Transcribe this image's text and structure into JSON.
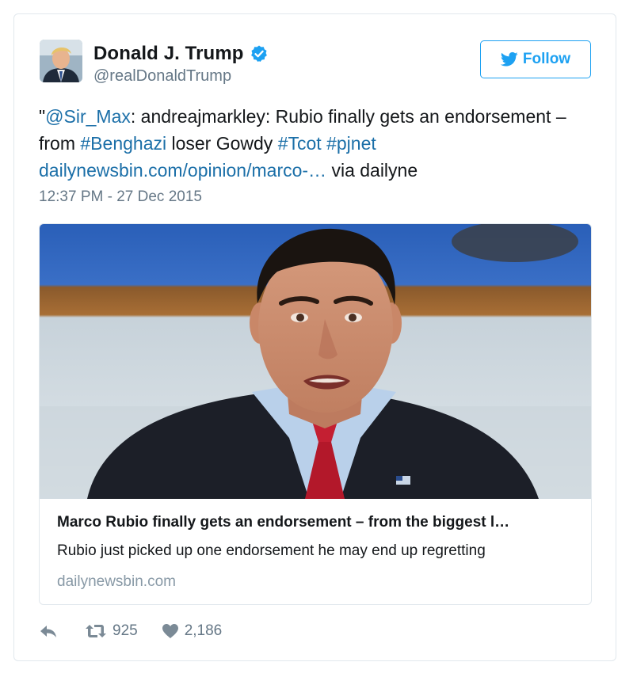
{
  "author": {
    "display_name": "Donald J. Trump",
    "handle": "@realDonaldTrump",
    "verified_icon": "verified-badge-icon",
    "avatar_icon": "avatar"
  },
  "follow_button": {
    "label": "Follow",
    "icon": "twitter-bird-icon"
  },
  "tweet": {
    "text_parts": {
      "quote_open": "\"",
      "mention": "@Sir_Max",
      "part1": ": andreajmarkley: Rubio finally gets an endorsement – from ",
      "hashtag_benghazi": "#Benghazi",
      "part2": " loser Gowdy ",
      "hashtag_tcot": "#Tcot",
      "space": " ",
      "hashtag_pjnet": "#pjnet",
      "link": "dailynewsbin.com/opinion/marco-…",
      "part3": " via dailyne"
    },
    "timestamp": "12:37 PM - 27 Dec 2015"
  },
  "link_card": {
    "title": "Marco Rubio finally gets an endorsement – from the biggest l…",
    "description": "Rubio just picked up one endorsement he may end up regretting",
    "domain": "dailynewsbin.com"
  },
  "actions": {
    "reply_icon": "reply-icon",
    "retweet_icon": "retweet-icon",
    "retweet_count": "925",
    "like_icon": "heart-icon",
    "like_count": "2,186"
  },
  "colors": {
    "accent": "#1da1f2",
    "link": "#1b6fa8",
    "secondary_text": "#657786",
    "border": "#e1e8ed"
  }
}
